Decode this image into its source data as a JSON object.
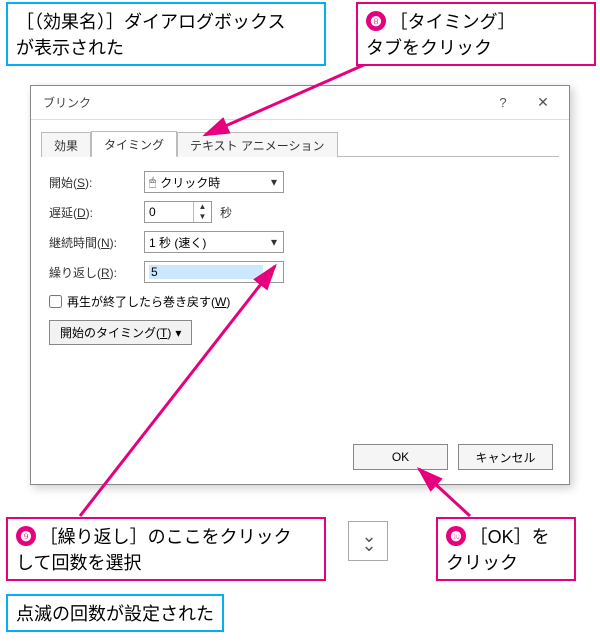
{
  "callouts": {
    "top_left": [
      "［（効果名）］ダイアログボックス",
      "が表示された"
    ],
    "top_right_num": "❽",
    "top_right": [
      "［タイミング］",
      "タブをクリック"
    ],
    "bottom_left_num": "❾",
    "bottom_left": [
      "［繰り返し］のここをクリック",
      "して回数を選択"
    ],
    "bottom_right_num": "❿",
    "bottom_right": [
      "［OK］を",
      "クリック"
    ],
    "result": "点滅の回数が設定された"
  },
  "dialog": {
    "title": "ブリンク",
    "help": "?",
    "close": "✕",
    "tabs": {
      "effect": "効果",
      "timing": "タイミング",
      "textanim": "テキスト アニメーション"
    },
    "labels": {
      "start": "開始(<u>S</u>):",
      "delay": "遅延(<u>D</u>):",
      "duration": "継続時間(<u>N</u>):",
      "repeat": "繰り返し(<u>R</u>):",
      "rewind": "再生が終了したら巻き戻す(<u>W</u>)",
      "triggers": "開始のタイミング(<u>T</u>) ",
      "sec": "秒"
    },
    "values": {
      "start": "クリック時",
      "delay": "0",
      "duration": "1 秒 (速く)",
      "repeat": "5"
    },
    "buttons": {
      "ok": "OK",
      "cancel": "キャンセル"
    }
  }
}
